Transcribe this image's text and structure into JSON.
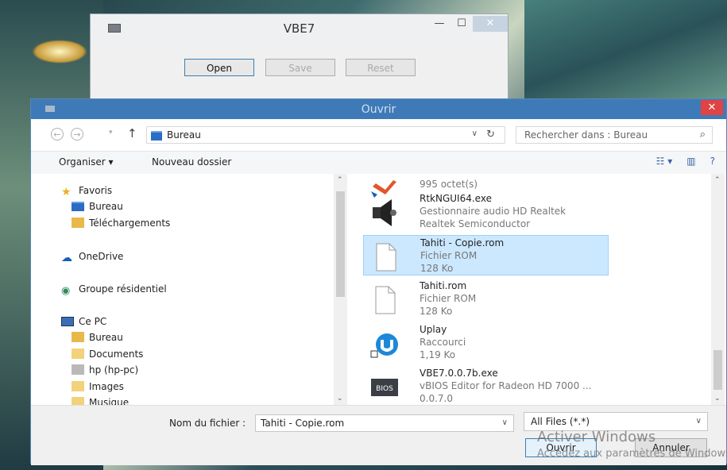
{
  "vbe": {
    "title": "VBE7",
    "buttons": {
      "open": "Open",
      "save": "Save",
      "reset": "Reset"
    },
    "controls": {
      "minimize": "—",
      "maximize": "☐",
      "close": "✕"
    }
  },
  "dialog": {
    "title": "Ouvrir",
    "close": "✕",
    "nav": {
      "back": "←",
      "forward": "→",
      "up": "↑",
      "location": "Bureau",
      "dropdown": "∨",
      "refresh": "↻"
    },
    "search": {
      "placeholder": "Rechercher dans : Bureau",
      "icon": "⌕"
    },
    "toolbar": {
      "organize": "Organiser ▾",
      "new_folder": "Nouveau dossier",
      "view_icon": "☷ ▾",
      "pane_icon": "▥",
      "help_icon": "?"
    },
    "sidebar": {
      "favorites": "Favoris",
      "fav_items": [
        "Bureau",
        "Téléchargements"
      ],
      "onedrive": "OneDrive",
      "homegroup": "Groupe résidentiel",
      "thispc": "Ce PC",
      "pc_items": [
        "Bureau",
        "Documents",
        "hp (hp-pc)",
        "Images",
        "Musique"
      ],
      "scroll_up": "⌃",
      "scroll_down": "⌄"
    },
    "files": [
      {
        "name": "",
        "line2": "995 octet(s)",
        "line3": ""
      },
      {
        "name": "RtkNGUI64.exe",
        "line2": "Gestionnaire audio HD Realtek",
        "line3": "Realtek Semiconductor"
      },
      {
        "name": "Tahiti - Copie.rom",
        "line2": "Fichier ROM",
        "line3": "128 Ko"
      },
      {
        "name": "Tahiti.rom",
        "line2": "Fichier ROM",
        "line3": "128 Ko"
      },
      {
        "name": "Uplay",
        "line2": "Raccourci",
        "line3": "1,19 Ko"
      },
      {
        "name": "VBE7.0.0.7b.exe",
        "line2": "vBIOS Editor for Radeon HD 7000 ...",
        "line3": "0.0.7.0"
      }
    ],
    "bios_label": "BIOS",
    "filename_label": "Nom du fichier :",
    "filename_value": "Tahiti - Copie.rom",
    "filetype_value": "All Files (*.*)",
    "ok": "Ouvrir",
    "cancel": "Annuler"
  },
  "watermark": {
    "line1": "Activer Windows",
    "line2": "Accédez aux paramètres de Windows"
  },
  "colors": {
    "accent": "#3f7ab8",
    "selection": "#cce8ff",
    "close_red": "#e04343"
  }
}
